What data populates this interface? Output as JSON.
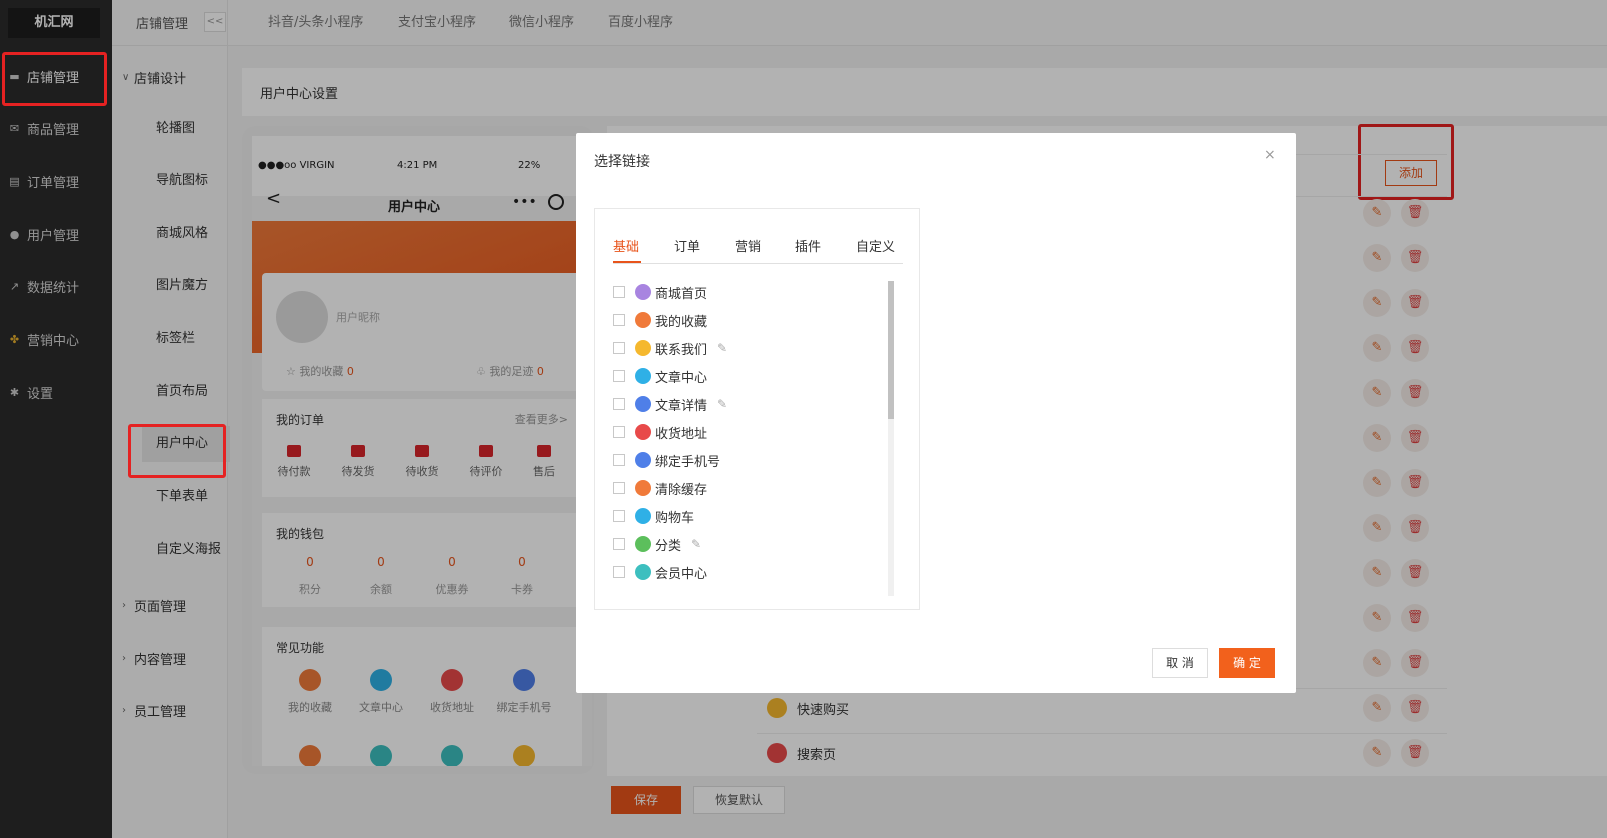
{
  "sidebar": {
    "logo": "机汇网",
    "items": [
      {
        "label": "店铺管理",
        "icon": "store-icon"
      },
      {
        "label": "商品管理",
        "icon": "goods-icon"
      },
      {
        "label": "订单管理",
        "icon": "order-icon"
      },
      {
        "label": "用户管理",
        "icon": "user-icon"
      },
      {
        "label": "数据统计",
        "icon": "chart-icon"
      },
      {
        "label": "营销中心",
        "icon": "marketing-icon"
      },
      {
        "label": "设置",
        "icon": "gear-icon"
      }
    ]
  },
  "subbar": {
    "title": "店铺管理",
    "collapse": "<<",
    "group_shop_design": "店铺设计",
    "items": [
      "轮播图",
      "导航图标",
      "商城风格",
      "图片魔方",
      "标签栏",
      "首页布局",
      "用户中心",
      "下单表单",
      "自定义海报"
    ],
    "groups_after": [
      "页面管理",
      "内容管理",
      "员工管理"
    ]
  },
  "topbar": {
    "tabs": [
      "抖音/头条小程序",
      "支付宝小程序",
      "微信小程序",
      "百度小程序"
    ]
  },
  "content": {
    "breadcrumb": "用户中心设置"
  },
  "phone": {
    "carrier": "●●●oo VIRGIN",
    "time": "4:21 PM",
    "battery": "22%",
    "nav_back": "<",
    "nav_title": "用户中心",
    "nav_dots": "•••",
    "nickname": "用户昵称",
    "favorites_label": "我的收藏",
    "favorites_count": "0",
    "footprints_label": "我的足迹",
    "footprints_count": "0",
    "orders_title": "我的订单",
    "orders_more": "查看更多>",
    "order_items": [
      "待付款",
      "待发货",
      "待收货",
      "待评价",
      "售后"
    ],
    "wallet_title": "我的钱包",
    "wallet_items": [
      {
        "value": "0",
        "label": "积分"
      },
      {
        "value": "0",
        "label": "余额"
      },
      {
        "value": "0",
        "label": "优惠券"
      },
      {
        "value": "0",
        "label": "卡券"
      }
    ],
    "functions_title": "常见功能",
    "function_items": [
      "我的收藏",
      "文章中心",
      "收货地址",
      "绑定手机号"
    ]
  },
  "right": {
    "add_label": "添加",
    "list_rows": [
      "快速购买",
      "搜索页"
    ]
  },
  "bottom": {
    "save": "保存",
    "reset": "恢复默认"
  },
  "modal": {
    "title": "选择链接",
    "close": "×",
    "tabs": [
      "基础",
      "订单",
      "营销",
      "插件",
      "自定义"
    ],
    "active_tab": 0,
    "links": [
      {
        "label": "商城首页",
        "color": "#a884e0",
        "editable": false
      },
      {
        "label": "我的收藏",
        "color": "#f07a3a",
        "editable": false
      },
      {
        "label": "联系我们",
        "color": "#f5b82e",
        "editable": true
      },
      {
        "label": "文章中心",
        "color": "#2fb0e6",
        "editable": false
      },
      {
        "label": "文章详情",
        "color": "#4f7fe8",
        "editable": true
      },
      {
        "label": "收货地址",
        "color": "#e84a4a",
        "editable": false
      },
      {
        "label": "绑定手机号",
        "color": "#4f7fe8",
        "editable": false
      },
      {
        "label": "清除缓存",
        "color": "#f07a3a",
        "editable": false
      },
      {
        "label": "购物车",
        "color": "#2fb0e6",
        "editable": false
      },
      {
        "label": "分类",
        "color": "#5cbf5c",
        "editable": true
      },
      {
        "label": "会员中心",
        "color": "#3dbfbf",
        "editable": false
      }
    ],
    "cancel": "取 消",
    "confirm": "确 定"
  },
  "colors": {
    "accent": "#e8541b",
    "sidebar_bg": "#2b2b2b",
    "annotation": "#e52222"
  }
}
